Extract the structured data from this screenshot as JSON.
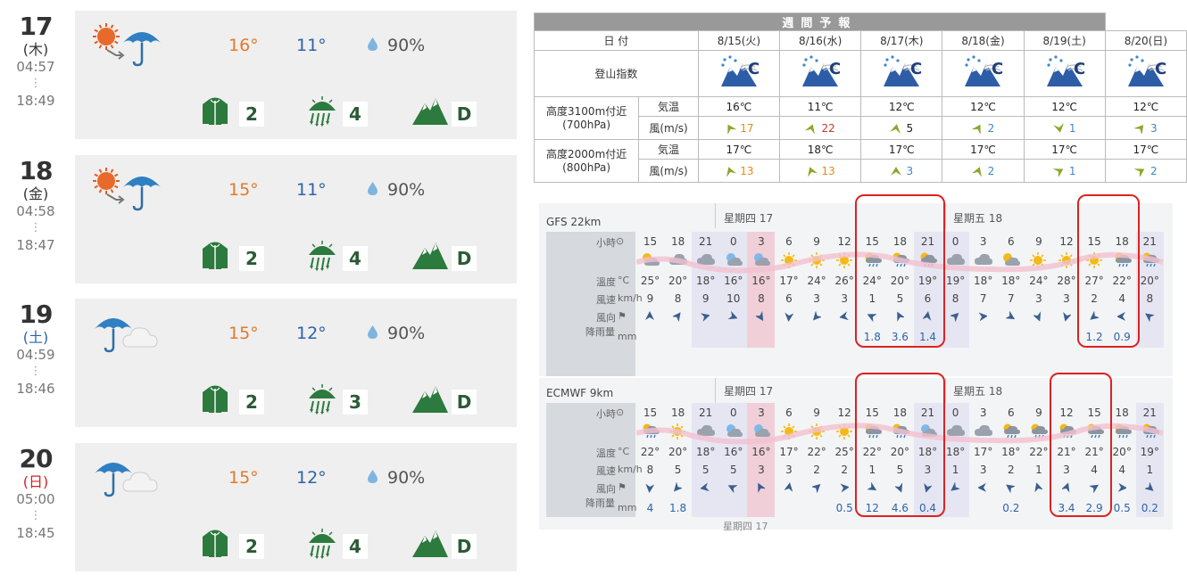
{
  "days": [
    {
      "num": "17",
      "dow": "(木)",
      "dow_color": "#333333",
      "sunrise": "04:57",
      "dots": "⋮",
      "sunset": "18:49",
      "icon": "sun-to-rain",
      "hi": "16°",
      "lo": "11°",
      "precip": "90%",
      "clothing": "2",
      "rain": "4",
      "climb": "D"
    },
    {
      "num": "18",
      "dow": "(金)",
      "dow_color": "#333333",
      "sunrise": "04:58",
      "dots": "⋮",
      "sunset": "18:47",
      "icon": "sun-to-rain",
      "hi": "15°",
      "lo": "11°",
      "precip": "90%",
      "clothing": "2",
      "rain": "4",
      "climb": "D"
    },
    {
      "num": "19",
      "dow": "(土)",
      "dow_color": "#2e63a8",
      "sunrise": "04:59",
      "dots": "⋮",
      "sunset": "18:46",
      "icon": "rain-cloud",
      "hi": "15°",
      "lo": "12°",
      "precip": "90%",
      "clothing": "2",
      "rain": "3",
      "climb": "D"
    },
    {
      "num": "20",
      "dow": "(日)",
      "dow_color": "#d22222",
      "sunrise": "05:00",
      "dots": "⋮",
      "sunset": "18:45",
      "icon": "rain-cloud",
      "hi": "15°",
      "lo": "12°",
      "precip": "90%",
      "clothing": "2",
      "rain": "4",
      "climb": "D"
    }
  ],
  "weekly": {
    "title": "週間予報",
    "date_label": "日 付",
    "index_label": "登山指数",
    "dates": [
      "8/15(火)",
      "8/16(水)",
      "8/17(木)",
      "8/18(金)",
      "8/19(土)",
      "8/20(日)"
    ],
    "grade": "C",
    "alt1_label": "高度3100m付近",
    "alt1_sub": "(700hPa)",
    "alt2_label": "高度2000m付近",
    "alt2_sub": "(800hPa)",
    "temp_label": "気温",
    "wind_label": "風(m/s)",
    "alt1_temps": [
      "16℃",
      "11℃",
      "12℃",
      "12℃",
      "12℃",
      "12℃"
    ],
    "alt1_winds": [
      "17",
      "22",
      "5",
      "2",
      "1",
      "3"
    ],
    "alt2_temps": [
      "17℃",
      "18℃",
      "17℃",
      "17℃",
      "17℃",
      "17℃"
    ],
    "alt2_winds": [
      "13",
      "13",
      "3",
      "2",
      "1",
      "2"
    ]
  },
  "models": [
    {
      "name": "GFS 22km",
      "day1": "星期四 17",
      "day2": "星期五 18",
      "row_labels": {
        "hour": "小時",
        "temp": "溫度",
        "wind": "風速",
        "dir": "風向",
        "rain": "降雨量"
      },
      "units": {
        "temp": "°C",
        "wind": "km/h",
        "rain": "mm"
      },
      "hours": [
        "15",
        "18",
        "21",
        "0",
        "3",
        "6",
        "9",
        "12",
        "15",
        "18",
        "21",
        "0",
        "3",
        "6",
        "9",
        "12",
        "15",
        "18",
        "21"
      ],
      "temps": [
        "25°",
        "20°",
        "18°",
        "16°",
        "16°",
        "17°",
        "24°",
        "26°",
        "24°",
        "20°",
        "19°",
        "19°",
        "18°",
        "18°",
        "24°",
        "28°",
        "27°",
        "22°",
        "20°"
      ],
      "winds": [
        "9",
        "8",
        "9",
        "10",
        "8",
        "6",
        "3",
        "3",
        "1",
        "5",
        "6",
        "8",
        "7",
        "7",
        "3",
        "3",
        "2",
        "4",
        "8"
      ],
      "rain": [
        "",
        "",
        "",
        "",
        "",
        "",
        "",
        "",
        "1.8",
        "3.6",
        "1.4",
        "",
        "",
        "",
        "",
        "",
        "1.2",
        "0.9",
        ""
      ]
    },
    {
      "name": "ECMWF 9km",
      "day1": "星期四 17",
      "day2": "星期五 18",
      "row_labels": {
        "hour": "小時",
        "temp": "溫度",
        "wind": "風速",
        "dir": "風向",
        "rain": "降雨量"
      },
      "units": {
        "temp": "°C",
        "wind": "km/h",
        "rain": "mm"
      },
      "hours": [
        "15",
        "18",
        "21",
        "0",
        "3",
        "6",
        "9",
        "12",
        "15",
        "18",
        "21",
        "0",
        "3",
        "6",
        "9",
        "12",
        "15",
        "18",
        "21"
      ],
      "temps": [
        "22°",
        "20°",
        "18°",
        "16°",
        "16°",
        "17°",
        "22°",
        "25°",
        "22°",
        "20°",
        "18°",
        "18°",
        "17°",
        "18°",
        "22°",
        "21°",
        "21°",
        "20°",
        "19°"
      ],
      "winds": [
        "8",
        "5",
        "5",
        "5",
        "3",
        "3",
        "2",
        "2",
        "1",
        "5",
        "3",
        "1",
        "3",
        "2",
        "1",
        "3",
        "4",
        "4",
        "1"
      ],
      "rain": [
        "4",
        "1.8",
        "",
        "",
        "",
        "",
        "",
        "0.5",
        "12",
        "4.6",
        "0.4",
        "",
        "",
        "0.2",
        "",
        "3.4",
        "2.9",
        "0.5",
        "0.2"
      ]
    }
  ],
  "footer_day": "星期四 17"
}
